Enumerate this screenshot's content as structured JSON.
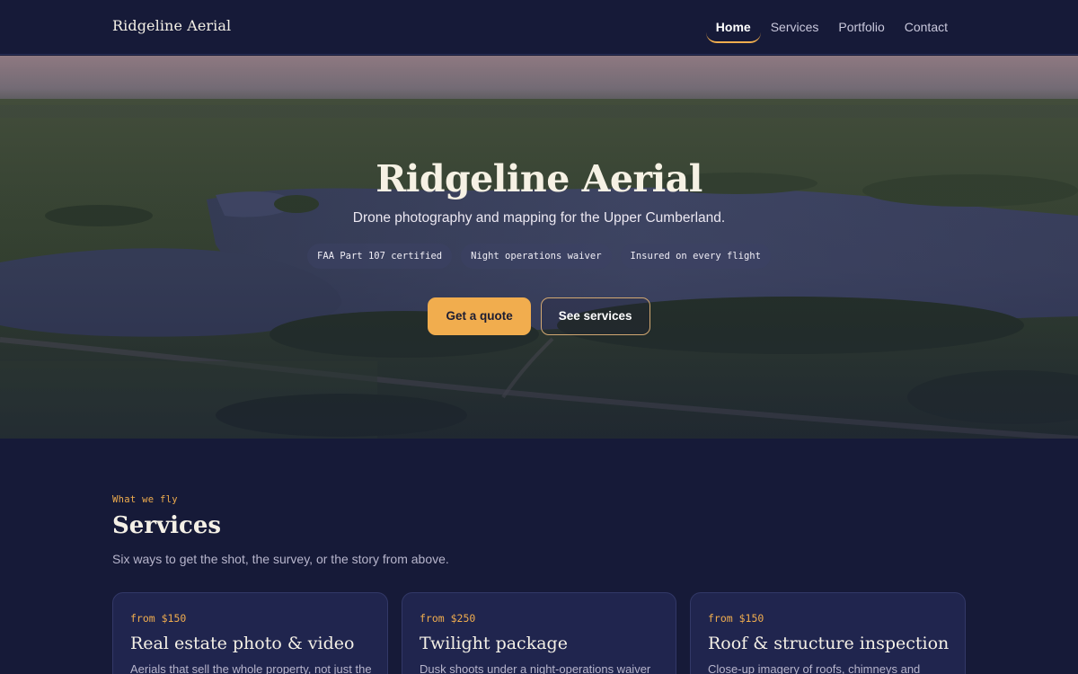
{
  "nav": {
    "brand": "Ridgeline Aerial",
    "links": [
      {
        "label": "Home",
        "active": true
      },
      {
        "label": "Services",
        "active": false
      },
      {
        "label": "Portfolio",
        "active": false
      },
      {
        "label": "Contact",
        "active": false
      }
    ]
  },
  "hero": {
    "title": "Ridgeline Aerial",
    "subtitle": "Drone photography and mapping for the Upper Cumberland.",
    "chips": [
      "FAA Part 107 certified",
      "Night operations waiver",
      "Insured on every flight"
    ],
    "primary_cta": "Get a quote",
    "secondary_cta": "See services"
  },
  "services": {
    "eyebrow": "What we fly",
    "title": "Services",
    "subtitle": "Six ways to get the shot, the survey, or the story from above.",
    "cards": [
      {
        "price": "from $150",
        "title": "Real estate photo & video",
        "description": "Aerials that sell the whole property, not just the"
      },
      {
        "price": "from $250",
        "title": "Twilight package",
        "description": "Dusk shoots under a night-operations waiver"
      },
      {
        "price": "from $150",
        "title": "Roof & structure inspection",
        "description": "Close-up imagery of roofs, chimneys and"
      }
    ]
  },
  "colors": {
    "background": "#161a38",
    "accent": "#f0ad4e",
    "card": "#20254e"
  }
}
